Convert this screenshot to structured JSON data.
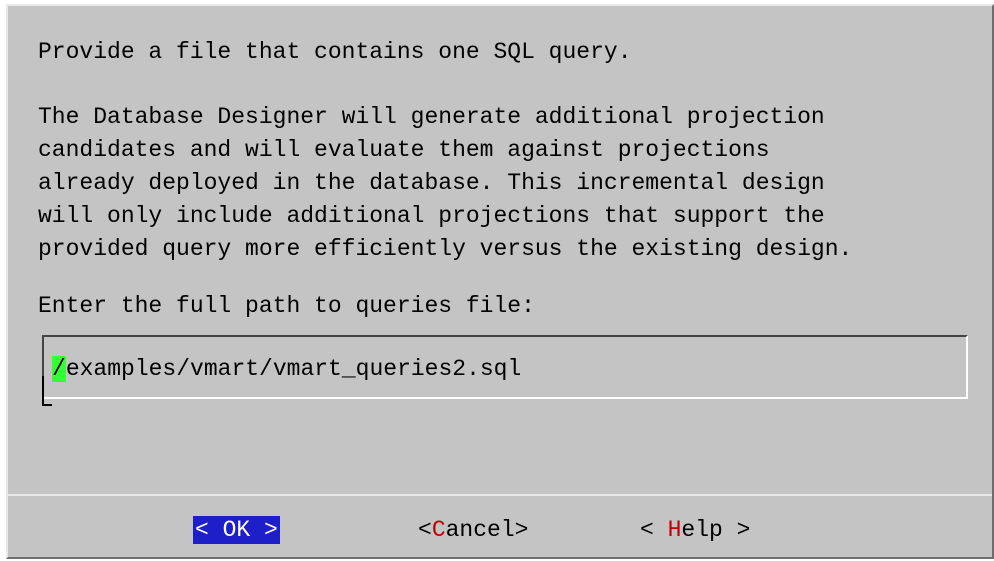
{
  "dialog": {
    "intro": "Provide a file that contains one SQL query.",
    "description_lines": [
      "The Database Designer will generate additional projection",
      "candidates and will evaluate them against projections",
      "already deployed in the database. This incremental design",
      "will only include additional projections that support the",
      "provided query more efficiently versus the existing design."
    ],
    "prompt": "Enter the full path to queries file:",
    "input": {
      "cursor_char": "/",
      "value_rest": "examples/vmart/vmart_queries2.sql"
    }
  },
  "buttons": {
    "ok": {
      "left": "< ",
      "hot": "OK",
      "right": " >",
      "pre": ""
    },
    "cancel": {
      "pre": "<",
      "hot": "C",
      "rest": "ancel>"
    },
    "help": {
      "pre": "< ",
      "hot": "H",
      "rest": "elp >"
    }
  },
  "colors": {
    "background": "#c4c4c4",
    "selected_button": "#1f1fc9",
    "hotkey": "#c00000",
    "cursor": "#33ff33"
  }
}
